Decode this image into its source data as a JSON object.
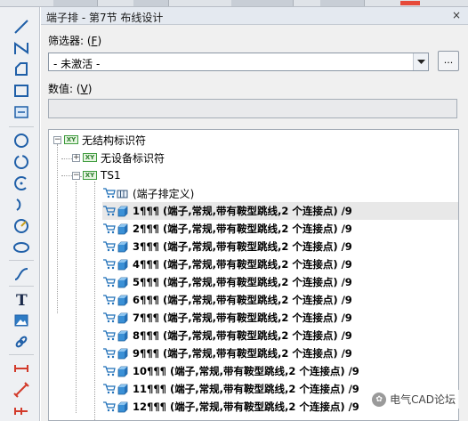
{
  "panel": {
    "title": "端子排 - 第7节 布线设计",
    "close": "×"
  },
  "filter": {
    "label_main": "筛选器: (",
    "label_key": "F",
    "label_end": ")",
    "selected": "- 未激活 -",
    "more_button": "..."
  },
  "value": {
    "label_main": "数值: (",
    "label_key": "V",
    "label_end": ")",
    "text": ""
  },
  "tree": {
    "root": "无结构标识符",
    "no_device": "无设备标识符",
    "strip": "TS1",
    "definition": "(端子排定义)",
    "terminals": [
      "1¶¶¶ (端子,常规,带有鞍型跳线,2 个连接点) /9",
      "2¶¶¶ (端子,常规,带有鞍型跳线,2 个连接点) /9",
      "3¶¶¶ (端子,常规,带有鞍型跳线,2 个连接点) /9",
      "4¶¶¶ (端子,常规,带有鞍型跳线,2 个连接点) /9",
      "5¶¶¶ (端子,常规,带有鞍型跳线,2 个连接点) /9",
      "6¶¶¶ (端子,常规,带有鞍型跳线,2 个连接点) /9",
      "7¶¶¶ (端子,常规,带有鞍型跳线,2 个连接点) /9",
      "8¶¶¶ (端子,常规,带有鞍型跳线,2 个连接点) /9",
      "9¶¶¶ (端子,常规,带有鞍型跳线,2 个连接点) /9",
      "10¶¶¶ (端子,常规,带有鞍型跳线,2 个连接点) /9",
      "11¶¶¶ (端子,常规,带有鞍型跳线,2 个连接点) /9",
      "12¶¶¶ (端子,常规,带有鞍型跳线,2 个连接点) /9"
    ]
  },
  "watermark": "电气CAD论坛",
  "colors": {
    "accent": "#3d9b3d",
    "icon_blue": "#1f6fb8",
    "selection": "#e8e8e8"
  }
}
